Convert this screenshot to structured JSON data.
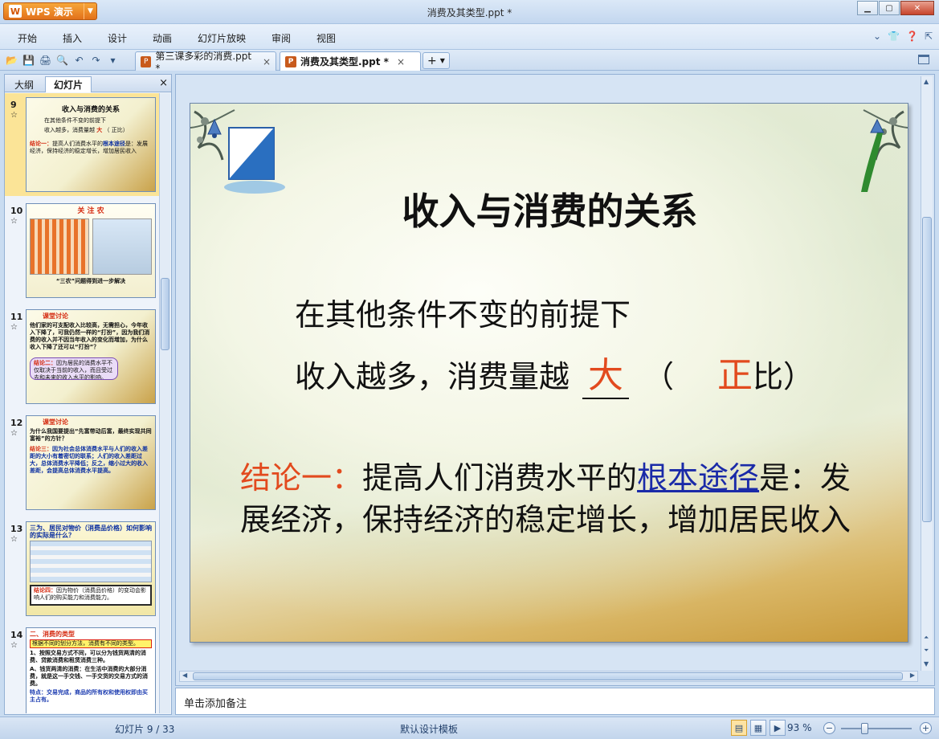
{
  "app": {
    "name": "WPS 演示",
    "window_title": "消费及其类型.ppt *"
  },
  "menu": [
    "开始",
    "插入",
    "设计",
    "动画",
    "幻灯片放映",
    "审阅",
    "视图"
  ],
  "tabs": [
    {
      "label": "第三课多彩的消费.ppt *",
      "close": "×"
    },
    {
      "label": "消费及其类型.ppt *",
      "close": "×"
    }
  ],
  "left_panel": {
    "tabs": [
      "大纲",
      "幻灯片"
    ],
    "close": "×",
    "thumbnails": [
      {
        "num": "9",
        "title": "收入与消费的关系",
        "line1": "在其他条件不变的前提下",
        "line2a": "收入越多，消费量越",
        "line2b": "大",
        "line2c": "（ 正比）",
        "concl_label": "结论一：",
        "concl_text": "提高人们消费水平的",
        "concl_link": "根本途径",
        "concl_rest": "是：发展经济，保持经济的稳定增长，增加居民收入"
      },
      {
        "num": "10",
        "title": "关 注 农",
        "caption": "“三农”问题得到进一步解决"
      },
      {
        "num": "11",
        "title": "课堂讨论",
        "body": "他们家的可支配收入比较高，无需担心，今年收入下降了，可我仍然一样的“打扮”，因为我们消费的收入并不因当年收入的变化而增加，为什么收入下降了还可以“打扮”？",
        "concl_label": "结论二：",
        "concl_text": "因为居民的消费水平不仅取决于当前的收入，而且受过去和未来的收入水平的影响。"
      },
      {
        "num": "12",
        "title": "课堂讨论",
        "body": "为什么我国要提出“先富带动后富，最终实现共同富裕”的方针？",
        "concl_label": "结论三：",
        "concl_text": "因为社会总体消费水平与人们的收入差距的大小有着密切的联系；人们的收入差距过大，总体消费水平降低；反之，缩小过大的收入差距，会提高总体消费水平提高。"
      },
      {
        "num": "13",
        "title": "三为、居民对物价（消费品价格）如何影响的实际是什么？",
        "concl_label": "结论四：",
        "concl_text": "因为物价（消费品价格）的变动会影响人们的购买能力和消费能力。"
      },
      {
        "num": "14",
        "title": "二、消费的类型",
        "line1": "根据不同的划分方法，消费有不同的类型。",
        "line2": "1、按照交易方式不同，可以分为钱货两清的消费、贷款消费和租赁消费三种。",
        "line3": "A、钱货两清的消费：在生活中消费的大部分消费，就是这一手交钱、一手交货的交易方式的消费。",
        "line4": "特点：交易完成，商品的所有权和使用权即由买主占有。"
      }
    ]
  },
  "slide": {
    "title": "收入与消费的关系",
    "line1": "在其他条件不变的前提下",
    "line2_prefix": "收入越多，消费量越",
    "answer1": "大",
    "paren_open": "（",
    "answer2": "正",
    "paren_close": "比）",
    "concl_label": "结论一：",
    "concl_text1": "提高人们消费水平的",
    "concl_link": "根本途径",
    "concl_text2": "是：发展经济，保持经济的稳定增长，增加居民收入"
  },
  "notes_placeholder": "单击添加备注",
  "status": {
    "slide_counter": "幻灯片 9 / 33",
    "template": "默认设计模板",
    "zoom": "93 %"
  }
}
